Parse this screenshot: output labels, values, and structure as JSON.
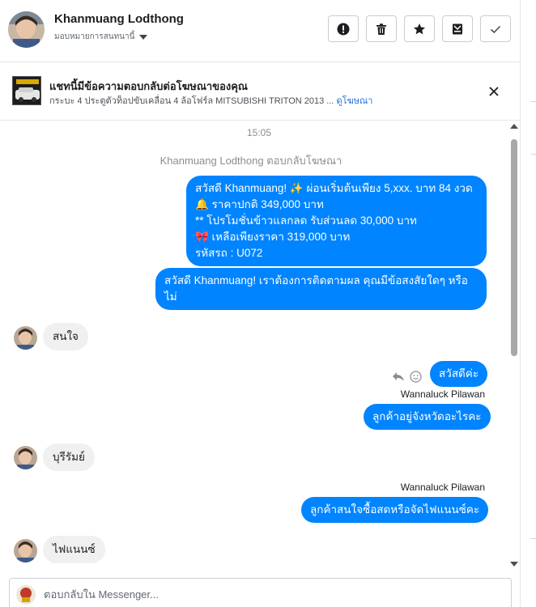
{
  "header": {
    "contact_name": "Khanmuang Lodthong",
    "assign_label": "มอบหมายการสนทนานี้",
    "actions": [
      {
        "name": "report-button",
        "icon": "exclamation-icon"
      },
      {
        "name": "delete-button",
        "icon": "trash-icon"
      },
      {
        "name": "star-button",
        "icon": "star-icon"
      },
      {
        "name": "archive-button",
        "icon": "archive-icon"
      },
      {
        "name": "done-button",
        "icon": "check-icon"
      }
    ]
  },
  "ad": {
    "title": "แชทนี้มีข้อความตอบกลับต่อโฆษณาของคุณ",
    "subtitle": "กระบะ 4 ประตูตัวท็อปขับเคลื่อน 4 ล้อโฟร์ล MITSUBISHI TRITON 2013 ...",
    "link": "ดูโฆษณา"
  },
  "thread": {
    "time": "15:05",
    "note": "Khanmuang Lodthong ตอบกลับโฆษณา",
    "outgoing_1": [
      "สวัสดี Khanmuang! ✨  ผ่อนเริ่มต้นเพียง 5,xxx. บาท 84 งวด",
      "🔔 ราคาปกติ 349,000 บาท",
      "** โปรโมชั่นข้าวแลกลด รับส่วนลด 30,000 บาท",
      "🎀  เหลือเพียงราคา 319,000 บาท",
      " รหัสรถ : U072"
    ],
    "outgoing_2": [
      "สวัสดี Khanmuang! เราต้องการติดตามผล คุณมีข้อสงสัยใดๆ หรือ",
      "ไม่"
    ],
    "incoming_1": "สนใจ",
    "outgoing_3": "สวัสดีค่ะ",
    "sender_1": "Wannaluck Pilawan",
    "outgoing_4": "ลูกค้าอยู่จังหวัดอะไรคะ",
    "incoming_2": "บุรีรัมย์",
    "sender_2": "Wannaluck Pilawan",
    "outgoing_5": "ลูกค้าสนใจซื้อสดหรือจัดไฟแนนซ์คะ",
    "incoming_3": "ไฟแนนซ์"
  },
  "composer": {
    "placeholder": "ตอบกลับใน Messenger..."
  },
  "colors": {
    "accent": "#0084ff",
    "incoming_bubble": "#f0f0f0",
    "link": "#216fdb"
  }
}
